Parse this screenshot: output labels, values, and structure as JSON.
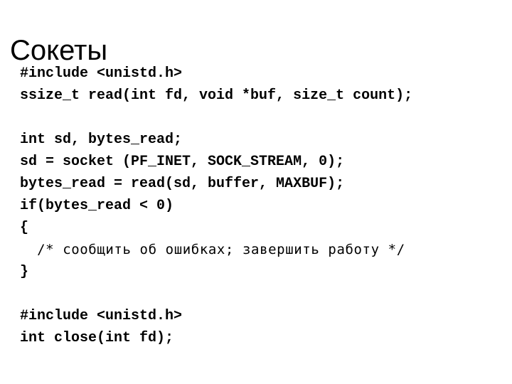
{
  "slide": {
    "title": "Сокеты",
    "background_color": "#ffffff",
    "text_color": "#000000",
    "code_lines": [
      {
        "text": "#include <unistd.h>",
        "style": "code"
      },
      {
        "text": "ssize_t read(int fd, void *buf, size_t count);",
        "style": "code"
      },
      {
        "text": "",
        "style": "blank"
      },
      {
        "text": "int sd, bytes_read;",
        "style": "code"
      },
      {
        "text": "sd = socket (PF_INET, SOCK_STREAM, 0);",
        "style": "code"
      },
      {
        "text": "bytes_read = read(sd, buffer, MAXBUF);",
        "style": "code"
      },
      {
        "text": "if(bytes_read < 0)",
        "style": "code"
      },
      {
        "text": "{",
        "style": "code"
      },
      {
        "text": "  /* сообщить об ошибках; завершить работу */",
        "style": "cyrillic"
      },
      {
        "text": "}",
        "style": "code"
      },
      {
        "text": "",
        "style": "blank"
      },
      {
        "text": "#include <unistd.h>",
        "style": "code"
      },
      {
        "text": "int close(int fd);",
        "style": "code"
      }
    ]
  }
}
